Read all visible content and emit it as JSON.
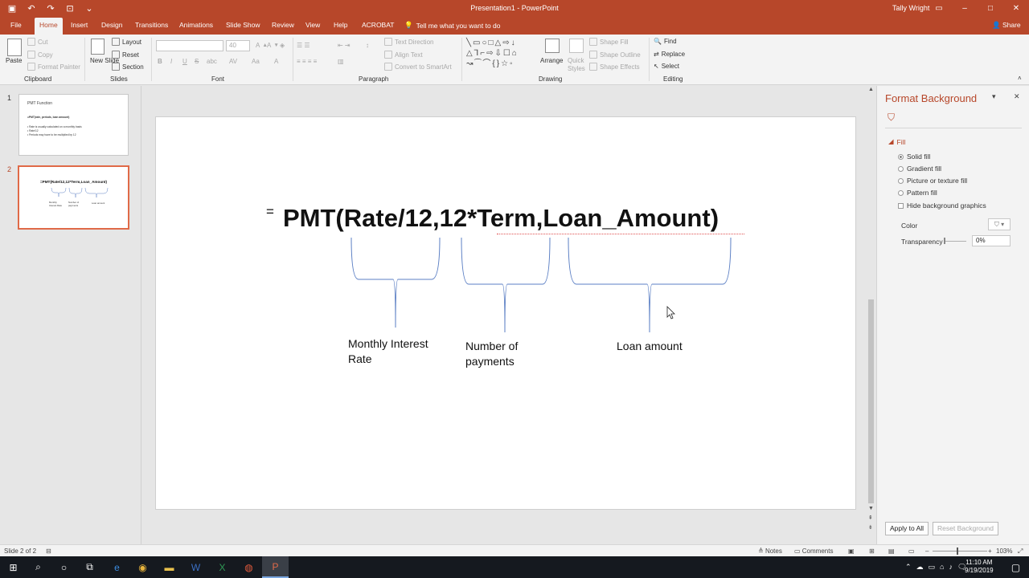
{
  "window": {
    "title": "Presentation1 - PowerPoint",
    "user": "Tally Wright",
    "controls": [
      "–",
      "□",
      "✕"
    ]
  },
  "qat": {
    "save_icon": "save-icon",
    "undo_icon": "undo-icon",
    "redo_icon": "redo-icon"
  },
  "tabs": [
    "File",
    "Home",
    "Insert",
    "Design",
    "Transitions",
    "Animations",
    "Slide Show",
    "Review",
    "View",
    "Help",
    "ACROBAT"
  ],
  "tell_me": "Tell me what you want to do",
  "share": "Share",
  "ribbon": {
    "clipboard": {
      "label": "Clipboard",
      "paste": "Paste",
      "cut": "Cut",
      "copy": "Copy",
      "format_painter": "Format Painter"
    },
    "slides": {
      "label": "Slides",
      "new_slide": "New Slide",
      "layout": "Layout",
      "reset": "Reset",
      "section": "Section"
    },
    "font": {
      "label": "Font",
      "font_name": "",
      "font_size": "40",
      "bold": "B",
      "italic": "I",
      "underline": "U",
      "strike": "S",
      "shadow": "abc",
      "spacing": "AV",
      "case": "Aa",
      "color": "A"
    },
    "paragraph": {
      "label": "Paragraph",
      "text_direction": "Text Direction",
      "align_text": "Align Text",
      "convert_smartart": "Convert to SmartArt"
    },
    "drawing": {
      "label": "Drawing",
      "arrange": "Arrange",
      "quick_styles": "Quick Styles",
      "shape_fill": "Shape Fill",
      "shape_outline": "Shape Outline",
      "shape_effects": "Shape Effects"
    },
    "editing": {
      "label": "Editing",
      "find": "Find",
      "replace": "Replace",
      "select": "Select"
    }
  },
  "thumbnails": [
    {
      "number": "1",
      "title": "PMT Function",
      "lines": [
        "=PMT(rate, periods, loan amount)",
        "• Rate is usually calculated on a monthly basis",
        "• Rate/12",
        "• Periods may have to be multiplied by 12"
      ]
    },
    {
      "number": "2",
      "title": "=PMT(Rate/12,12*Term,Loan_Amount)",
      "labels": [
        "Monthly Interest Rate",
        "Number of payments",
        "Loan amount"
      ]
    }
  ],
  "slide": {
    "formula_prefix": "=",
    "formula": "PMT(Rate/12,12*Term,Loan_Amount)",
    "labels": {
      "rate_line1": "Monthly Interest",
      "rate_line2": "Rate",
      "payments_line1": "Number of",
      "payments_line2": "payments",
      "loan": "Loan amount"
    }
  },
  "pane": {
    "title": "Format Background",
    "fill_section": "Fill",
    "options": [
      "Solid fill",
      "Gradient fill",
      "Picture or texture fill",
      "Pattern fill"
    ],
    "selected_option": "Solid fill",
    "hide_graphics": "Hide background graphics",
    "color_label": "Color",
    "transparency_label": "Transparency",
    "transparency_value": "0%",
    "apply_all": "Apply to All",
    "reset_bg": "Reset Background"
  },
  "status": {
    "slide_info": "Slide 2 of 2",
    "notes": "Notes",
    "comments": "Comments",
    "zoom": "103%"
  },
  "taskbar": {
    "time": "11:10 AM",
    "date": "9/19/2019"
  },
  "colors": {
    "accent": "#b7472a",
    "thumb_selected": "#e06a48",
    "brace": "#5b7fc4"
  }
}
